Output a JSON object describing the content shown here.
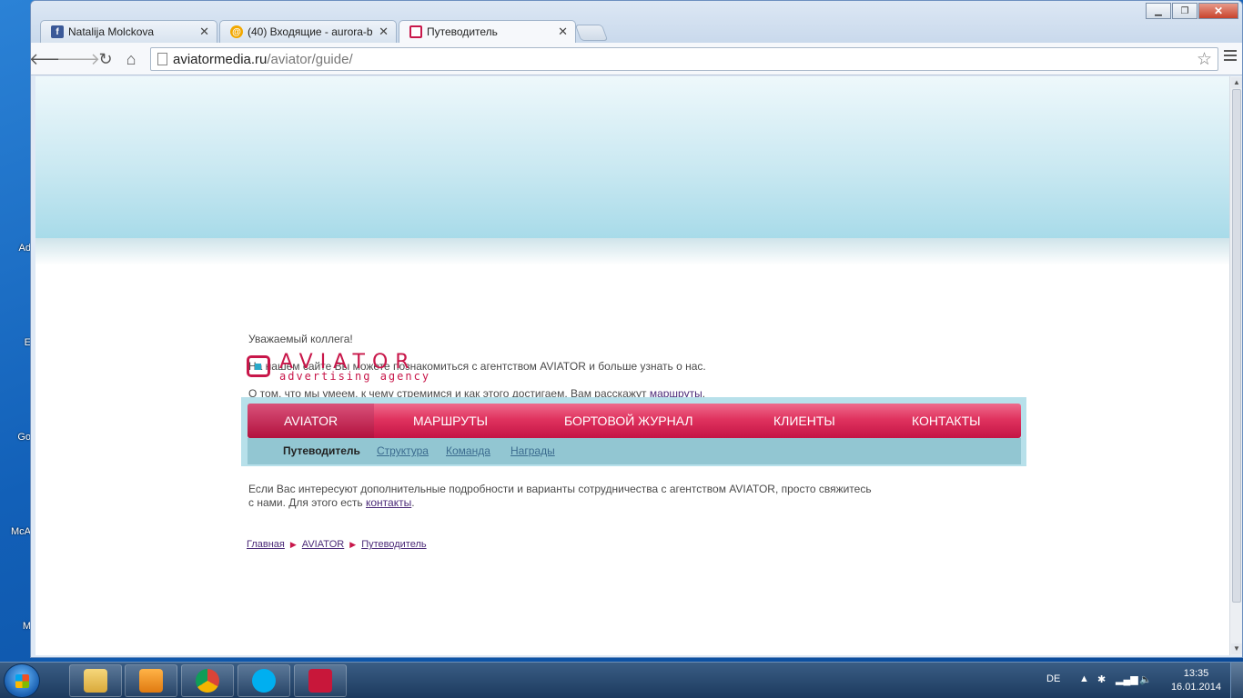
{
  "desktop": {
    "labels": [
      "Ad",
      "E",
      "Go",
      "McA",
      "M"
    ]
  },
  "browser": {
    "tabs": [
      {
        "title": "Natalija Molckova",
        "icon": "facebook-icon"
      },
      {
        "title": "(40) Входящие - aurora-b",
        "icon": "mail-icon"
      },
      {
        "title": "Путеводитель",
        "icon": "aviator-favicon"
      }
    ],
    "url_domain": "aviatormedia.ru",
    "url_path": "/aviator/guide/"
  },
  "page": {
    "greeting": "Уважаемый коллега!",
    "intro": "На нашем сайте Вы можете познакомиться с агентством AVIATOR и больше узнать о нас.",
    "about_prefix": "О том, что мы умеем, к чему стремимся и как этого достигаем, Вам расскажут",
    "about_link": "маршруты",
    "contact_text": "Если Вас интересуют дополнительные подробности и варианты сотрудничества с агентством AVIATOR, просто свяжитесь",
    "contact_text2": "с нами.  Для этого есть",
    "contact_link": "контакты",
    "logo": {
      "word": "AVIATOR",
      "tagline": "advertising agency"
    },
    "main_nav": [
      "AVIATOR",
      "МАРШРУТЫ",
      "БОРТОВОЙ  ЖУРНАЛ",
      "КЛИЕНТЫ",
      "КОНТАКТЫ"
    ],
    "sub_nav": [
      "Путеводитель",
      "Структура",
      "Команда",
      "Награды"
    ],
    "breadcrumb": [
      "Главная",
      "AVIATOR",
      "Путеводитель"
    ]
  },
  "taskbar": {
    "language": "DE",
    "time": "13:35",
    "date": "16.01.2014"
  },
  "colors": {
    "brand": "#c8174a",
    "nav_panel": "#b7e0ea"
  }
}
